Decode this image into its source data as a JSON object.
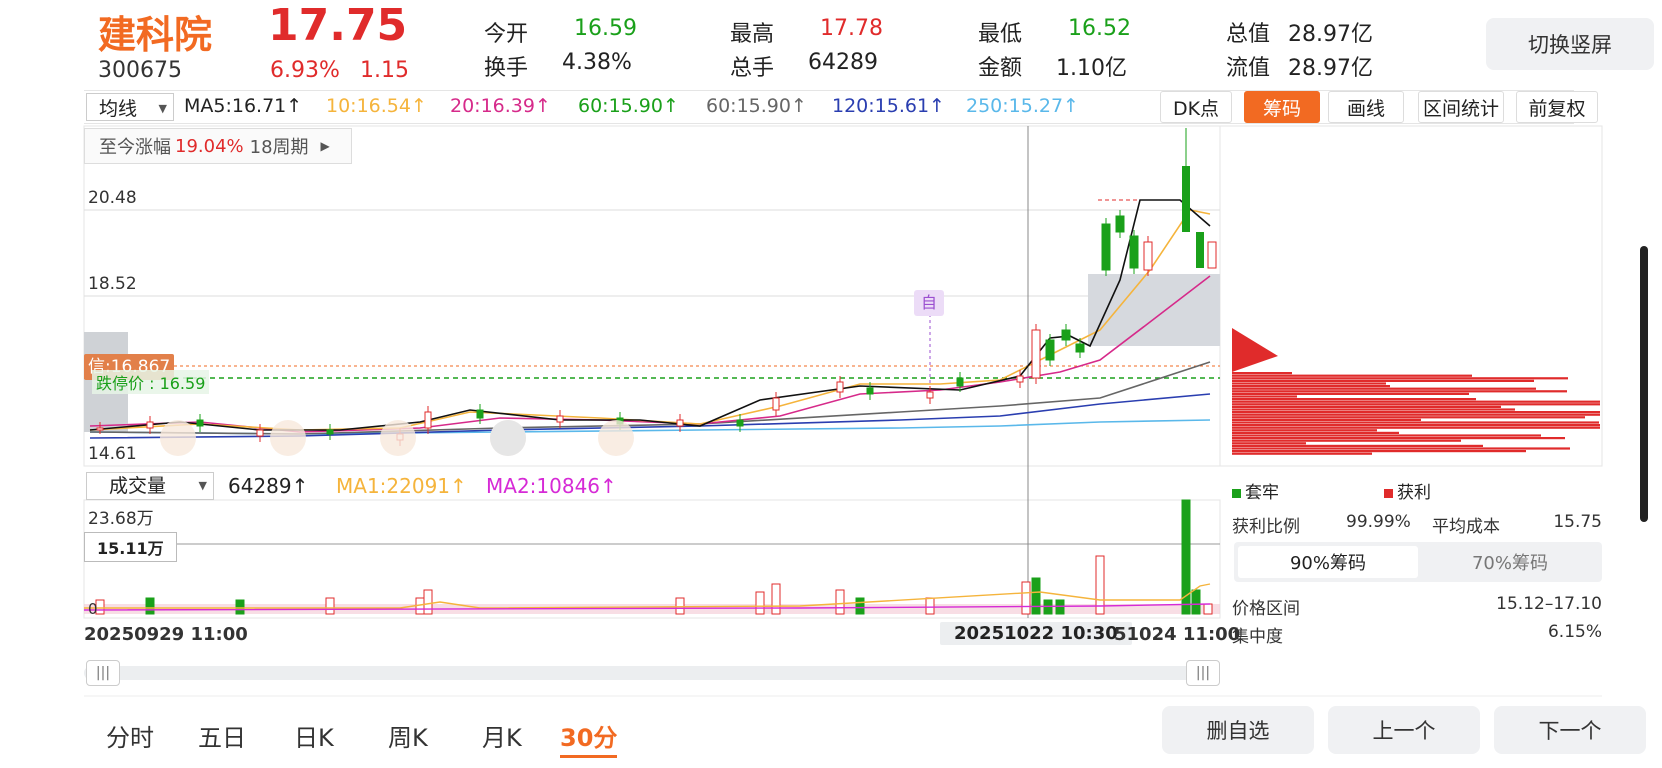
{
  "header": {
    "name": "建科院",
    "code": "300675",
    "price": "17.75",
    "change_pct": "6.93%",
    "change_amt": "1.15",
    "quotes": [
      {
        "label": "今开",
        "value": "16.59",
        "color": "#1aa01a"
      },
      {
        "label": "换手",
        "value": "4.38%",
        "color": "#222222"
      },
      {
        "label": "最高",
        "value": "17.78",
        "color": "#e02b2b"
      },
      {
        "label": "总手",
        "value": "64289",
        "color": "#222222"
      },
      {
        "label": "最低",
        "value": "16.52",
        "color": "#1aa01a"
      },
      {
        "label": "金额",
        "value": "1.10亿",
        "color": "#222222"
      },
      {
        "label": "总值",
        "value": "28.97亿",
        "color": "#222222"
      },
      {
        "label": "流值",
        "value": "28.97亿",
        "color": "#222222"
      }
    ],
    "switch_label": "切换竖屏"
  },
  "ma_bar": {
    "dropdown": "均线",
    "items": [
      {
        "text": "MA5:16.71↑",
        "color": "#222222"
      },
      {
        "text": "10:16.54↑",
        "color": "#f5b43c"
      },
      {
        "text": "20:16.39↑",
        "color": "#d62a8a"
      },
      {
        "text": "60:15.90↑",
        "color": "#1aa01a"
      },
      {
        "text": "60:15.90↑",
        "color": "#666666"
      },
      {
        "text": "120:15.61↑",
        "color": "#2a3eb0"
      },
      {
        "text": "250:15.27↑",
        "color": "#5ab8ea"
      }
    ],
    "tools": [
      "DK点",
      "筹码",
      "画线",
      "区间统计",
      "前复权"
    ]
  },
  "chart": {
    "zhangfu_label": "至今涨幅",
    "zhangfu_value": "19.04%",
    "zhangfu_period": "18周期",
    "y_labels": [
      "20.48",
      "18.52",
      "14.61"
    ],
    "xin_label": "信:16.867",
    "stop_label": "跌停价 : 16.59",
    "marker_label": "自",
    "colors": {
      "up": "#e02b2b",
      "down": "#1aa01a",
      "accent": "#f26a22"
    }
  },
  "volume": {
    "dropdown": "成交量",
    "value": "64289↑",
    "ma1": "MA1:22091↑",
    "ma2": "MA2:10846↑",
    "y_top": "23.68万",
    "y_mid": "15.11万",
    "y_zero": "0"
  },
  "x_axis": {
    "start": "20250929 11:00",
    "cursor": "20251022 10:30",
    "end": "51024 11:00"
  },
  "chips": {
    "legend_trap": "套牢",
    "legend_profit": "获利",
    "profit_ratio_label": "获利比例",
    "profit_ratio": "99.99%",
    "avg_cost_label": "平均成本",
    "avg_cost": "15.75",
    "tab90": "90%筹码",
    "tab70": "70%筹码",
    "range_label": "价格区间",
    "range": "15.12–17.10",
    "conc_label": "集中度",
    "conc": "6.15%"
  },
  "bottom": {
    "tabs": [
      "分时",
      "五日",
      "日K",
      "周K",
      "月K",
      "30分"
    ],
    "buttons": [
      "删自选",
      "上一个",
      "下一个"
    ]
  }
}
